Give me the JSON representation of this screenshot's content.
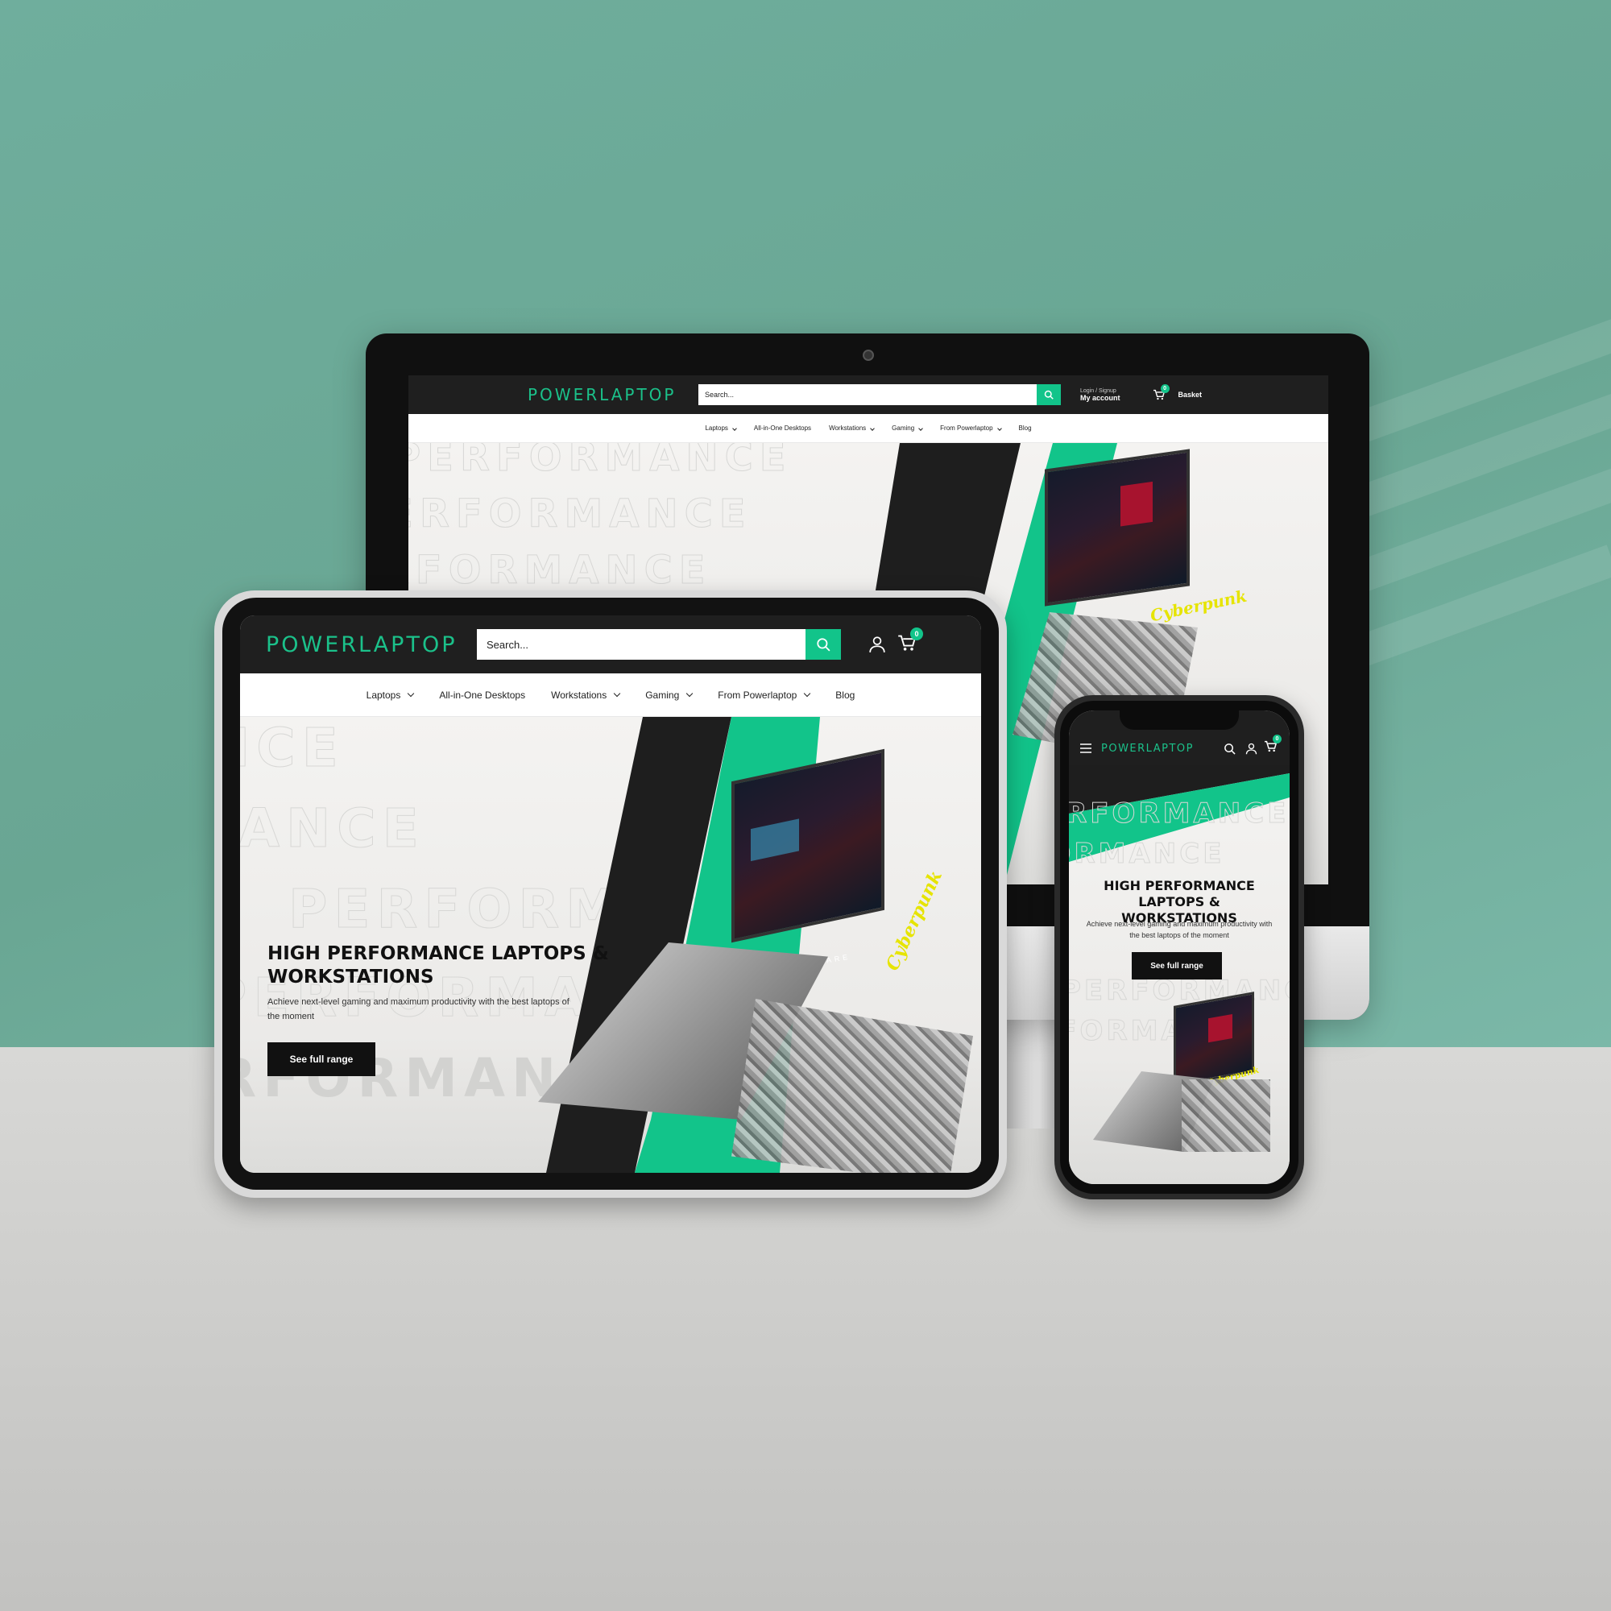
{
  "brand": {
    "name": "POWERLAPTOP",
    "accent": "#12c48a",
    "dark": "#1f1f1f"
  },
  "search": {
    "placeholder": "Search..."
  },
  "account": {
    "login_label": "Login / Signup",
    "my_account": "My account"
  },
  "cart": {
    "label": "Basket",
    "count": "0"
  },
  "nav": {
    "items": [
      {
        "label": "Laptops",
        "dropdown": true
      },
      {
        "label": "All-in-One Desktops",
        "dropdown": false
      },
      {
        "label": "Workstations",
        "dropdown": true
      },
      {
        "label": "Gaming",
        "dropdown": true
      },
      {
        "label": "From Powerlaptop",
        "dropdown": true
      },
      {
        "label": "Blog",
        "dropdown": false
      }
    ]
  },
  "hero": {
    "watermark": "PERFORMANCE",
    "title": "HIGH PERFORMANCE LAPTOPS & WORKSTATIONS",
    "subtitle": "Achieve next-level gaming and maximum productivity with the best laptops of the moment",
    "cta": "See full range",
    "product_text": "ALIENWARE",
    "game_logo": "Cyberpunk"
  },
  "icons": [
    "search-icon",
    "user-icon",
    "cart-icon",
    "hamburger-icon",
    "chevron-down-icon"
  ]
}
